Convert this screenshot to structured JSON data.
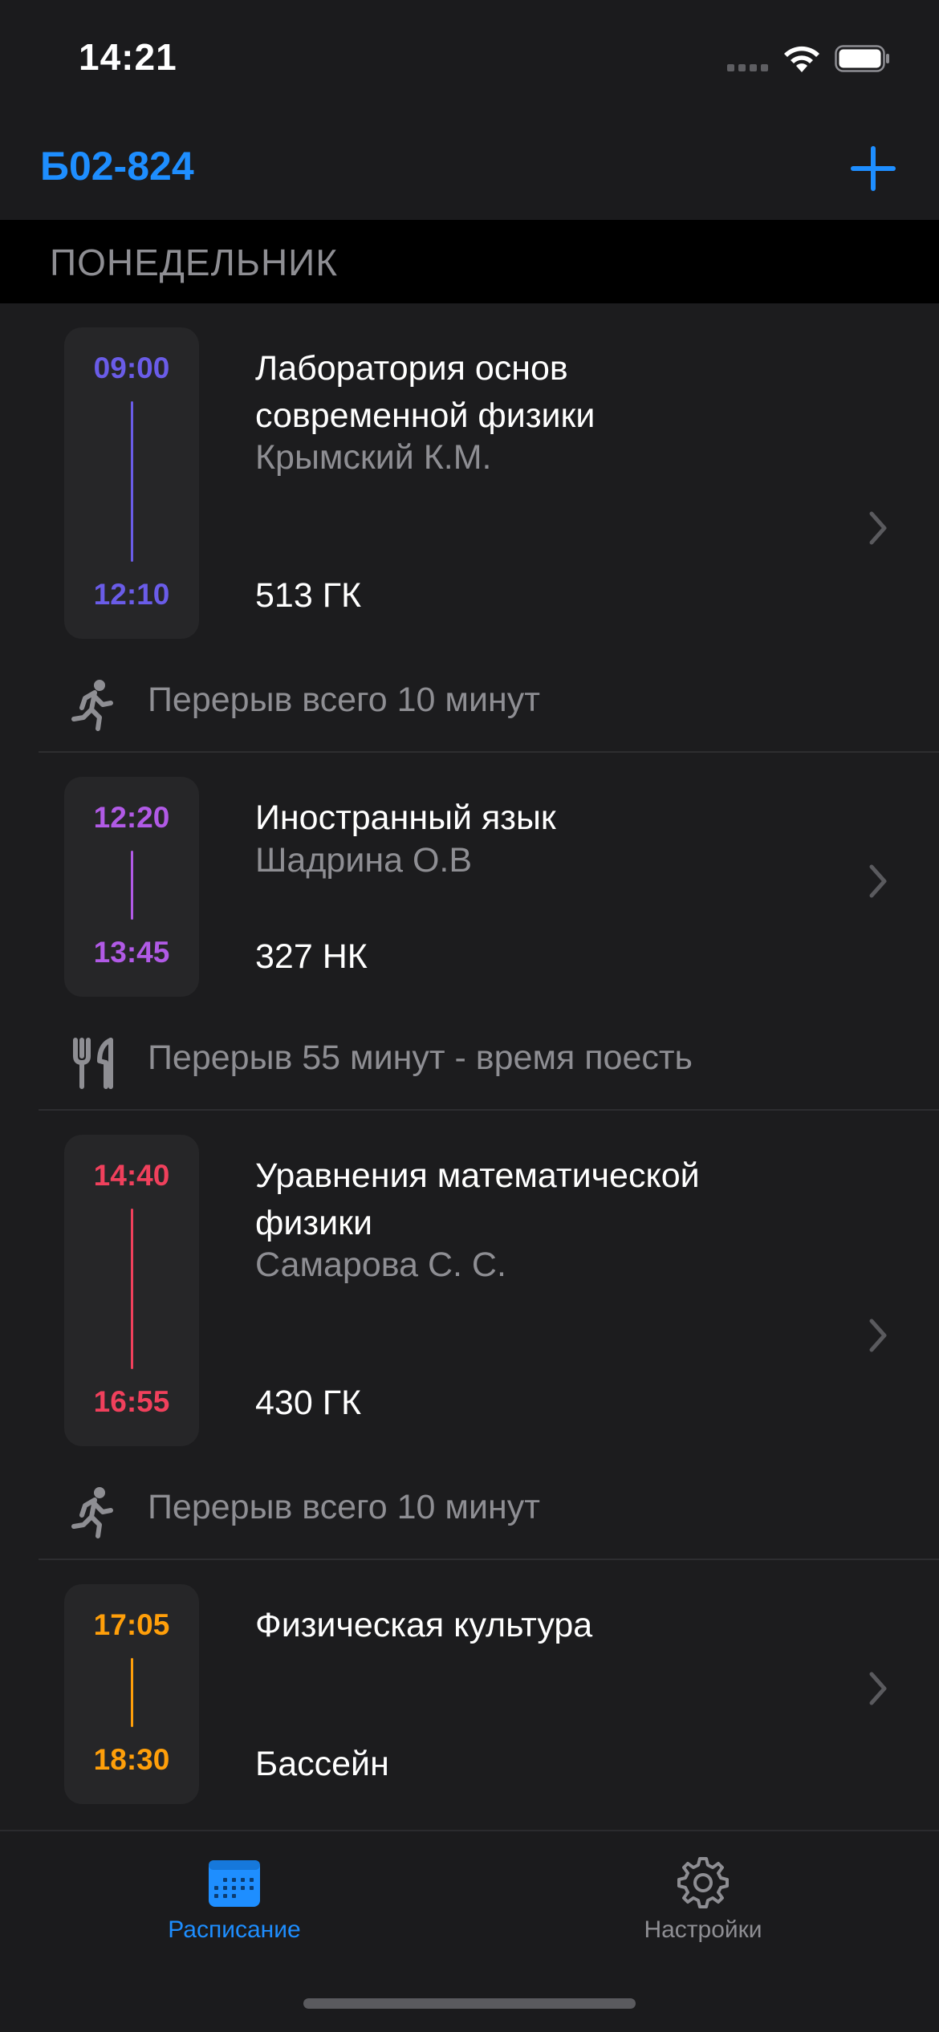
{
  "status_bar": {
    "time": "14:21"
  },
  "nav": {
    "title": "Б02-824"
  },
  "section": {
    "day": "ПОНЕДЕЛЬНИК"
  },
  "lessons": [
    {
      "start": "09:00",
      "end": "12:10",
      "title_line1": "Лаборатория основ",
      "title_line2": "современной физики",
      "teacher": "Крымский К.М.",
      "room": "513 ГК",
      "color": "#6a5ce8"
    },
    {
      "start": "12:20",
      "end": "13:45",
      "title_line1": "Иностранный язык",
      "title_line2": "",
      "teacher": "Шадрина О.В",
      "room": "327 НК",
      "color": "#b15ae6"
    },
    {
      "start": "14:40",
      "end": "16:55",
      "title_line1": "Уравнения математической",
      "title_line2": "физики",
      "teacher": "Самарова С. С.",
      "room": "430 ГК",
      "color": "#f0405c"
    },
    {
      "start": "17:05",
      "end": "18:30",
      "title_line1": "Физическая культура",
      "title_line2": "",
      "teacher": "",
      "room": "Бассейн",
      "color": "#ff9f0a"
    }
  ],
  "breaks": [
    {
      "text": "Перерыв всего 10 минут",
      "icon": "running-icon"
    },
    {
      "text": "Перерыв 55 минут - время поесть",
      "icon": "fork-knife-icon"
    },
    {
      "text": "Перерыв всего 10 минут",
      "icon": "running-icon"
    }
  ],
  "tabs": [
    {
      "label": "Расписание",
      "icon": "calendar-icon",
      "active": true
    },
    {
      "label": "Настройки",
      "icon": "gear-icon",
      "active": false
    }
  ],
  "colors": {
    "accent": "#1e8eff",
    "secondary_text": "#8e8e93",
    "inactive_tab": "#8e8e93"
  }
}
